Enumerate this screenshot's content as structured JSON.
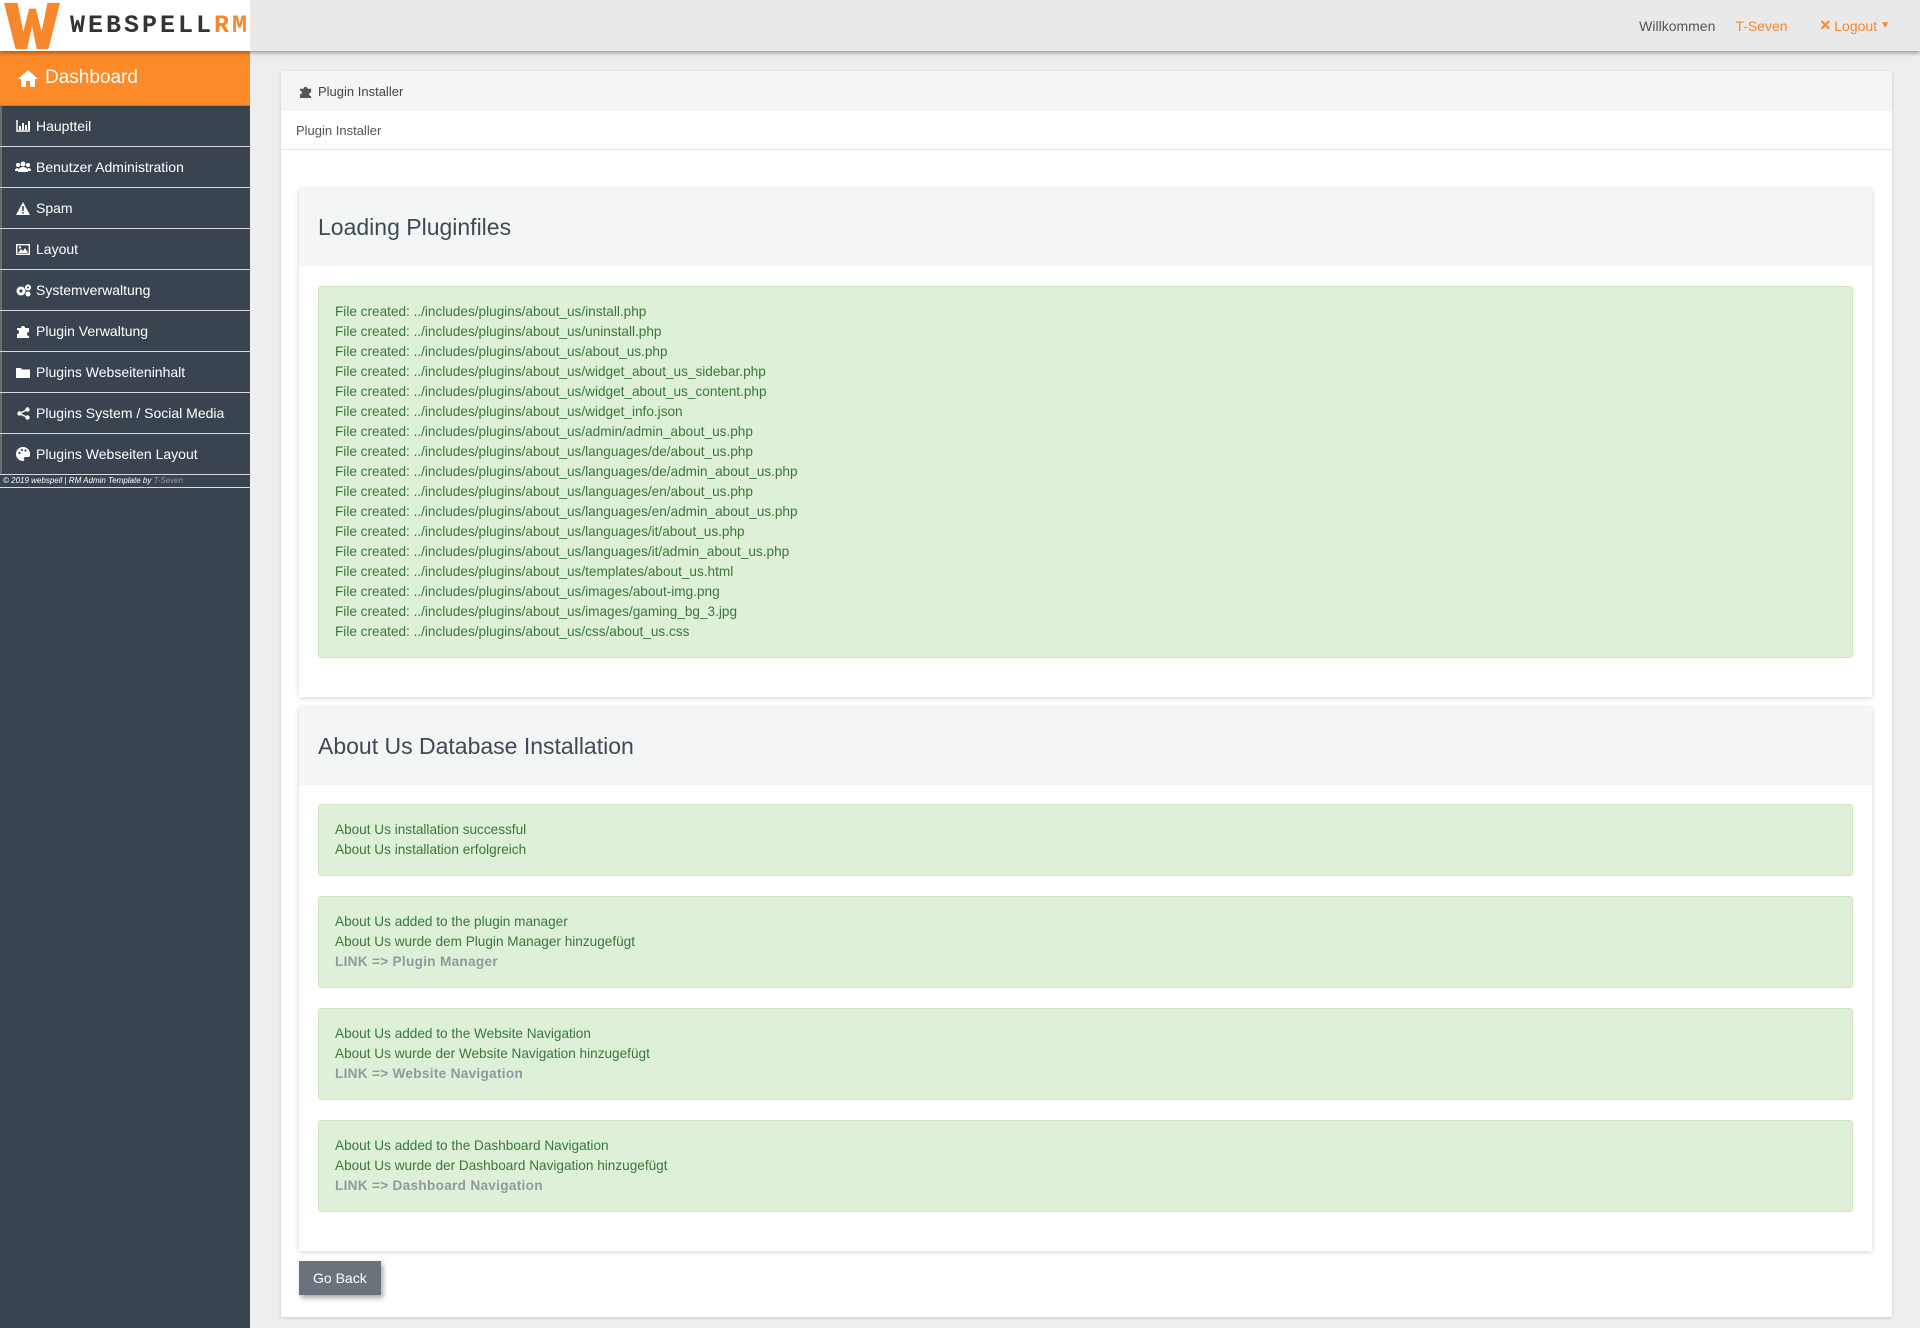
{
  "brand": {
    "name_main": "WEBSPELL",
    "name_accent": "RM"
  },
  "topnav": {
    "welcome": "Willkommen",
    "user": "T-Seven",
    "logout": "Logout"
  },
  "sidebar": {
    "dashboard": "Dashboard",
    "items": [
      {
        "label": "Hauptteil",
        "icon": "chart-icon"
      },
      {
        "label": "Benutzer Administration",
        "icon": "users-icon"
      },
      {
        "label": "Spam",
        "icon": "warning-icon"
      },
      {
        "label": "Layout",
        "icon": "image-icon"
      },
      {
        "label": "Systemverwaltung",
        "icon": "cogs-icon"
      },
      {
        "label": "Plugin Verwaltung",
        "icon": "puzzle-icon"
      },
      {
        "label": "Plugins Webseiteninhalt",
        "icon": "folder-icon"
      },
      {
        "label": "Plugins System / Social Media",
        "icon": "share-icon"
      },
      {
        "label": "Plugins Webseiten Layout",
        "icon": "palette-icon"
      }
    ],
    "copyright": "© 2019 webspell | RM Admin Template by",
    "copyright_by": "T-Seven"
  },
  "panel": {
    "heading": "Plugin Installer",
    "breadcrumb": "Plugin Installer"
  },
  "files_card": {
    "title": "Loading Pluginfiles",
    "lines": [
      "File created:  ../includes/plugins/about_us/install.php",
      "File created:  ../includes/plugins/about_us/uninstall.php",
      "File created:  ../includes/plugins/about_us/about_us.php",
      "File created:  ../includes/plugins/about_us/widget_about_us_sidebar.php",
      "File created:  ../includes/plugins/about_us/widget_about_us_content.php",
      "File created:  ../includes/plugins/about_us/widget_info.json",
      "File created:  ../includes/plugins/about_us/admin/admin_about_us.php",
      "File created:  ../includes/plugins/about_us/languages/de/about_us.php",
      "File created:  ../includes/plugins/about_us/languages/de/admin_about_us.php",
      "File created:  ../includes/plugins/about_us/languages/en/about_us.php",
      "File created:  ../includes/plugins/about_us/languages/en/admin_about_us.php",
      "File created:  ../includes/plugins/about_us/languages/it/about_us.php",
      "File created:  ../includes/plugins/about_us/languages/it/admin_about_us.php",
      "File created:  ../includes/plugins/about_us/templates/about_us.html",
      "File created:  ../includes/plugins/about_us/images/about-img.png",
      "File created:  ../includes/plugins/about_us/images/gaming_bg_3.jpg",
      "File created:  ../includes/plugins/about_us/css/about_us.css"
    ]
  },
  "db_card": {
    "title": "About Us Database Installation",
    "install": {
      "line1": "About Us installation successful",
      "line2": "About Us installation erfolgreich"
    },
    "plugin_manager": {
      "line1": "About Us added to the plugin manager",
      "line2": "About Us wurde dem Plugin Manager hinzugefügt",
      "link": "LINK => Plugin Manager"
    },
    "website_nav": {
      "line1": "About Us added to the Website Navigation",
      "line2": "About Us wurde der Website Navigation hinzugefügt",
      "link": "LINK => Website Navigation"
    },
    "dashboard_nav": {
      "line1": "About Us added to the Dashboard Navigation",
      "line2": "About Us wurde der Dashboard Navigation hinzugefügt",
      "link": "LINK => Dashboard Navigation"
    }
  },
  "go_back": "Go Back",
  "colors": {
    "accent": "#fc8a28",
    "sidebar": "#3a4450",
    "success_bg": "#def0d8",
    "success_text": "#3c763d"
  }
}
